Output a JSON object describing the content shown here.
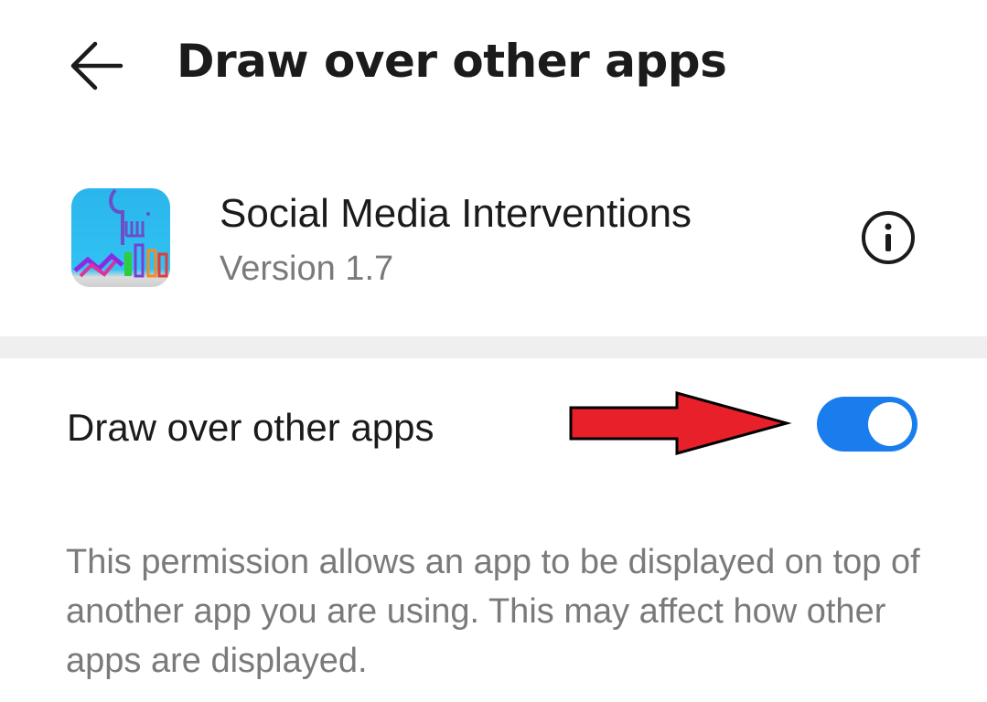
{
  "header": {
    "back_icon": "arrow-left-icon",
    "title": "Draw over other apps"
  },
  "app": {
    "icon": "social-media-interventions-app-icon",
    "name": "Social Media Interventions",
    "version": "Version 1.7",
    "info_icon": "info-icon"
  },
  "setting": {
    "label": "Draw over other apps",
    "enabled": true,
    "toggle_color": "#1a7dee",
    "annotation_color": "#e8202a"
  },
  "description": "This permission allows an app to be displayed on top of another app you are using. This may affect how other apps are displayed."
}
